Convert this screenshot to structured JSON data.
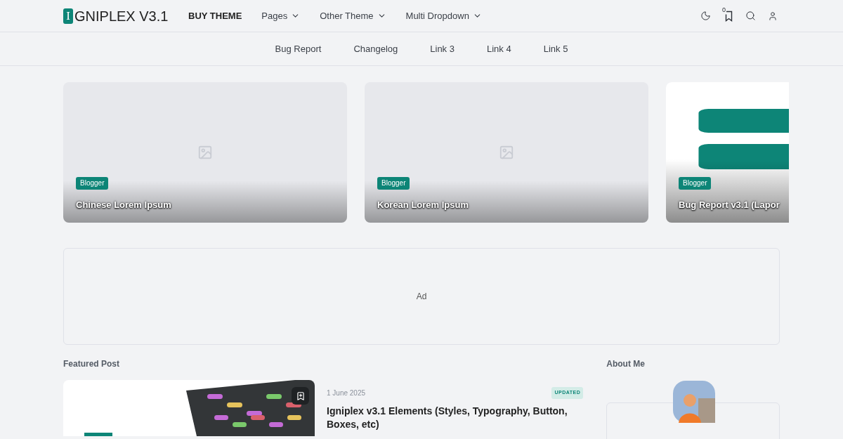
{
  "logo": {
    "letter": "I",
    "text": "GNIPLEX V3.1"
  },
  "nav": [
    {
      "label": "BUY THEME",
      "dropdown": false,
      "bold": true
    },
    {
      "label": "Pages",
      "dropdown": true,
      "bold": false
    },
    {
      "label": "Other Theme",
      "dropdown": true,
      "bold": false
    },
    {
      "label": "Multi Dropdown",
      "dropdown": true,
      "bold": false
    }
  ],
  "bookmark_count": "0",
  "subnav": [
    "Bug Report",
    "Changelog",
    "Link 3",
    "Link 4",
    "Link 5"
  ],
  "slides": [
    {
      "kind": "placeholder",
      "tag": "Blogger",
      "title": "Chinese Lorem Ipsum"
    },
    {
      "kind": "placeholder",
      "tag": "Blogger",
      "title": "Korean Lorem Ipsum"
    },
    {
      "kind": "picture",
      "tag": "Blogger",
      "title": "Bug Report v3.1 (Lapor"
    }
  ],
  "ad": "Ad",
  "featured": {
    "heading": "Featured Post",
    "date": "1 June 2025",
    "badge": "UPDATED",
    "title": "Igniplex v3.1 Elements (Styles, Typography, Button, Boxes, etc)"
  },
  "about": {
    "heading": "About Me"
  }
}
